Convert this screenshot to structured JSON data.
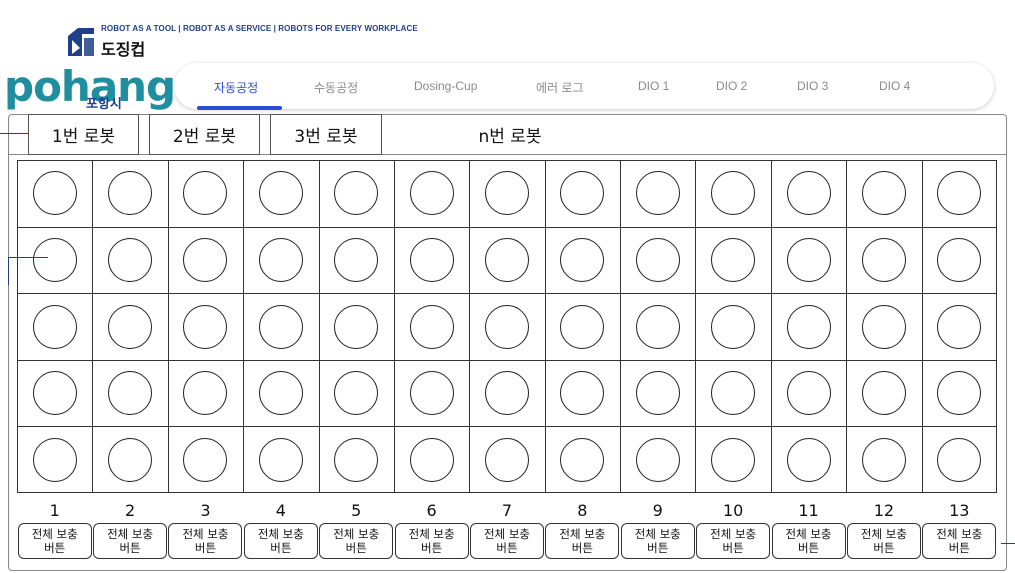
{
  "header": {
    "tagline": "ROBOT AS A TOOL | ROBOT AS A SERVICE | ROBOTS FOR EVERY WORKPLACE",
    "brand_name": "도징컵",
    "city_logo": "pohang",
    "city_name": "포항시"
  },
  "nav": {
    "tabs": [
      {
        "label": "자동공정",
        "active": true
      },
      {
        "label": "수동공정",
        "active": false
      },
      {
        "label": "Dosing-Cup",
        "active": false
      },
      {
        "label": "에러 로그",
        "active": false
      },
      {
        "label": "DIO 1",
        "active": false
      },
      {
        "label": "DIO 2",
        "active": false
      },
      {
        "label": "DIO 3",
        "active": false
      },
      {
        "label": "DIO 4",
        "active": false
      }
    ],
    "active_color": "#2c4bd6",
    "inactive_color": "#8a8a8a"
  },
  "robot_tabs": [
    "1번 로봇",
    "2번 로봇",
    "3번 로봇",
    "n번 로봇"
  ],
  "grid": {
    "columns": [
      "1",
      "2",
      "3",
      "4",
      "5",
      "6",
      "7",
      "8",
      "9",
      "10",
      "11",
      "12",
      "13"
    ],
    "rows": 5,
    "fill_button_label": "전체 보충\n버튼"
  }
}
